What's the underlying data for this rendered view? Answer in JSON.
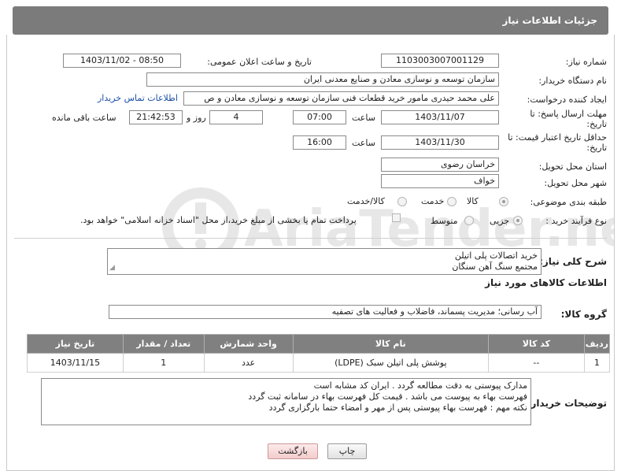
{
  "page": {
    "title": "جزئیات اطلاعات نیاز"
  },
  "form": {
    "need_number_label": "شماره نیاز:",
    "need_number": "1103003007001129",
    "announce_label": "تاریخ و ساعت اعلان عمومی:",
    "announce_value": "1403/11/02 - 08:50",
    "buyer_org_label": "نام دستگاه خریدار:",
    "buyer_org": "سازمان توسعه و نوسازی معادن و صنایع معدنی ایران",
    "requester_label": "ایجاد کننده درخواست:",
    "requester": "علی محمد حیدری مامور خرید قطعات فنی سازمان توسعه و نوسازی معادن و ص",
    "contact_link": "اطلاعات تماس خریدار",
    "deadline_label_line1": "مهلت ارسال پاسخ: تا",
    "deadline_label_line2": "تاریخ:",
    "deadline_date": "1403/11/07",
    "time_label": "ساعت",
    "deadline_time": "07:00",
    "days_value": "4",
    "days_label": "روز و",
    "remaining_time": "21:42:53",
    "remaining_label": "ساعت باقی مانده",
    "validity_label_line1": "حداقل تاریخ اعتبار قیمت: تا",
    "validity_label_line2": "تاریخ:",
    "validity_date": "1403/11/30",
    "validity_time_label": "ساعت",
    "validity_time": "16:00",
    "province_label": "استان محل تحویل:",
    "province": "خراسان رضوی",
    "city_label": "شهر محل تحویل:",
    "city": "خواف",
    "category_label": "طبقه بندی موضوعی:",
    "category_options": [
      "کالا",
      "خدمت",
      "کالا/خدمت"
    ],
    "process_label": "نوع فرآیند خرید :",
    "process_options": [
      "جزیی",
      "متوسط"
    ],
    "payment_note": "پرداخت تمام یا بخشی از مبلغ خرید،از محل \"اسناد خزانه اسلامی\" خواهد بود."
  },
  "description": {
    "label": "شرح کلی نیاز:",
    "line1": "خرید اتصالات پلی اتیلن",
    "line2": "مجتمع سنگ آهن سنگان"
  },
  "goods": {
    "section_title": "اطلاعات کالاهای مورد نیاز",
    "group_label": "گروه کالا:",
    "group_value": "آب رسانی؛ مدیریت پسماند، فاضلاب و فعالیت های تصفیه",
    "columns": [
      "ردیف",
      "کد کالا",
      "نام کالا",
      "واحد شمارش",
      "تعداد / مقدار",
      "تاریخ نیاز"
    ],
    "rows": [
      [
        "1",
        "--",
        "پوشش پلی اتیلن سبک (LDPE)",
        "عدد",
        "1",
        "1403/11/15"
      ]
    ]
  },
  "buyer_notes": {
    "label": "توضیحات خریدار:",
    "line1": "مدارک پیوستی به دقت مطالعه گردد . ایران کد مشابه است",
    "line2": "فهرست بهاء به پیوست می باشد . قیمت کل فهرست بهاء در سامانه ثبت گردد",
    "line3": "نکته مهم : فهرست بهاء پیوستی پس از مهر و امضاء حتما بارگزاری گردد"
  },
  "buttons": {
    "print": "چاپ",
    "back": "بازگشت"
  },
  "watermark": {
    "text": "AriaTender.neT"
  },
  "colors": {
    "header_bg": "#7b7b7b",
    "table_header_bg": "#808080",
    "link": "#1a4fa8",
    "back_button_bg": "#f3cccc"
  }
}
